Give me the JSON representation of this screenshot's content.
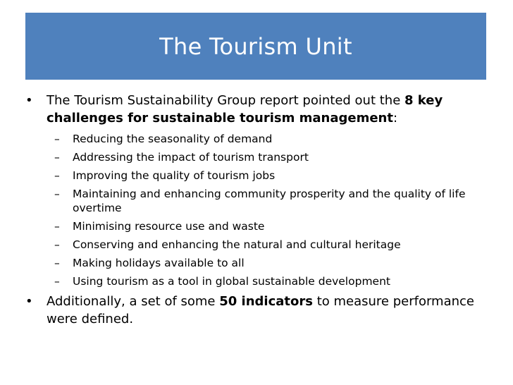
{
  "slide": {
    "title": "The Tourism Unit",
    "bullet1": {
      "text_before": "The Tourism Sustainability Group report pointed out the ",
      "bold": "8 key challenges for sustainable tourism management",
      "text_after": ":"
    },
    "challenges": [
      "Reducing the seasonality of demand",
      "Addressing the impact of tourism transport",
      "Improving the quality of tourism jobs",
      "Maintaining and enhancing community prosperity and the quality of life overtime",
      "Minimising resource use and waste",
      "Conserving and enhancing the natural and cultural heritage",
      "Making holidays available to all",
      "Using tourism as a tool in global sustainable development"
    ],
    "bullet2": {
      "text_before": "Additionally, a set of some ",
      "bold": "50 indicators",
      "text_after": " to measure performance were defined."
    },
    "colors": {
      "title_bg": "#4f81bd",
      "title_text": "#ffffff"
    }
  }
}
